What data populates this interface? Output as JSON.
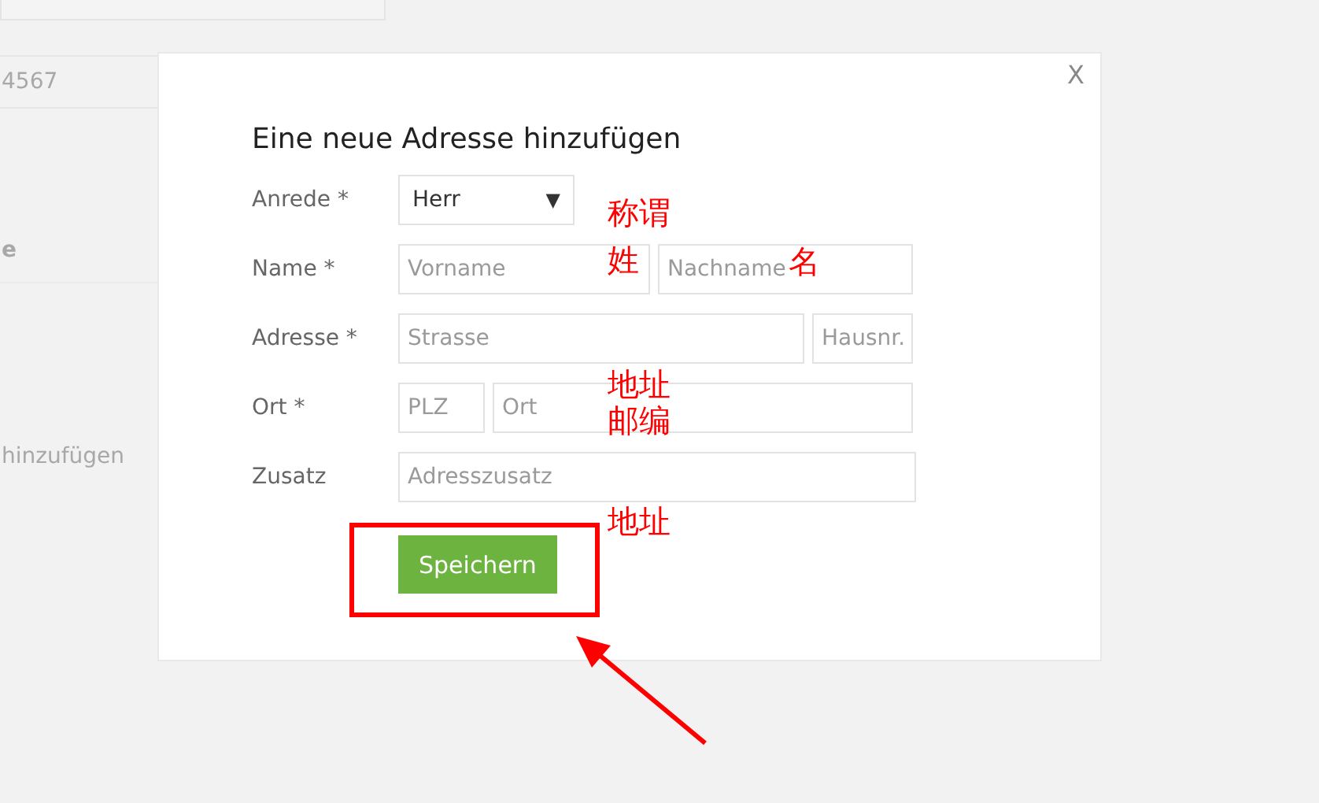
{
  "background": {
    "texts": [
      {
        "text": "4567"
      },
      {
        "text": "e"
      },
      {
        "text": "hinzufügen"
      }
    ]
  },
  "dialog": {
    "close": "X",
    "title": "Eine neue Adresse hinzufügen",
    "rows": [
      {
        "label": "Anrede *",
        "fields": [
          {
            "kind": "select",
            "value": "Herr",
            "caret": "▼"
          }
        ]
      },
      {
        "label": "Name *",
        "fields": [
          {
            "kind": "input",
            "placeholder": "Vorname"
          },
          {
            "kind": "input",
            "placeholder": "Nachname"
          }
        ]
      },
      {
        "label": "Adresse *",
        "fields": [
          {
            "kind": "input",
            "placeholder": "Strasse"
          },
          {
            "kind": "input",
            "placeholder": "Hausnr."
          }
        ]
      },
      {
        "label": "Ort *",
        "fields": [
          {
            "kind": "input",
            "placeholder": "PLZ"
          },
          {
            "kind": "input",
            "placeholder": "Ort"
          }
        ]
      },
      {
        "label": "Zusatz",
        "fields": [
          {
            "kind": "input",
            "placeholder": "Adresszusatz"
          }
        ]
      }
    ],
    "button": "Speichern"
  },
  "annotations": [
    {
      "text": "称谓"
    },
    {
      "text": "姓"
    },
    {
      "text": "名"
    },
    {
      "text": "地址"
    },
    {
      "text": "邮编"
    },
    {
      "text": "地址"
    }
  ]
}
